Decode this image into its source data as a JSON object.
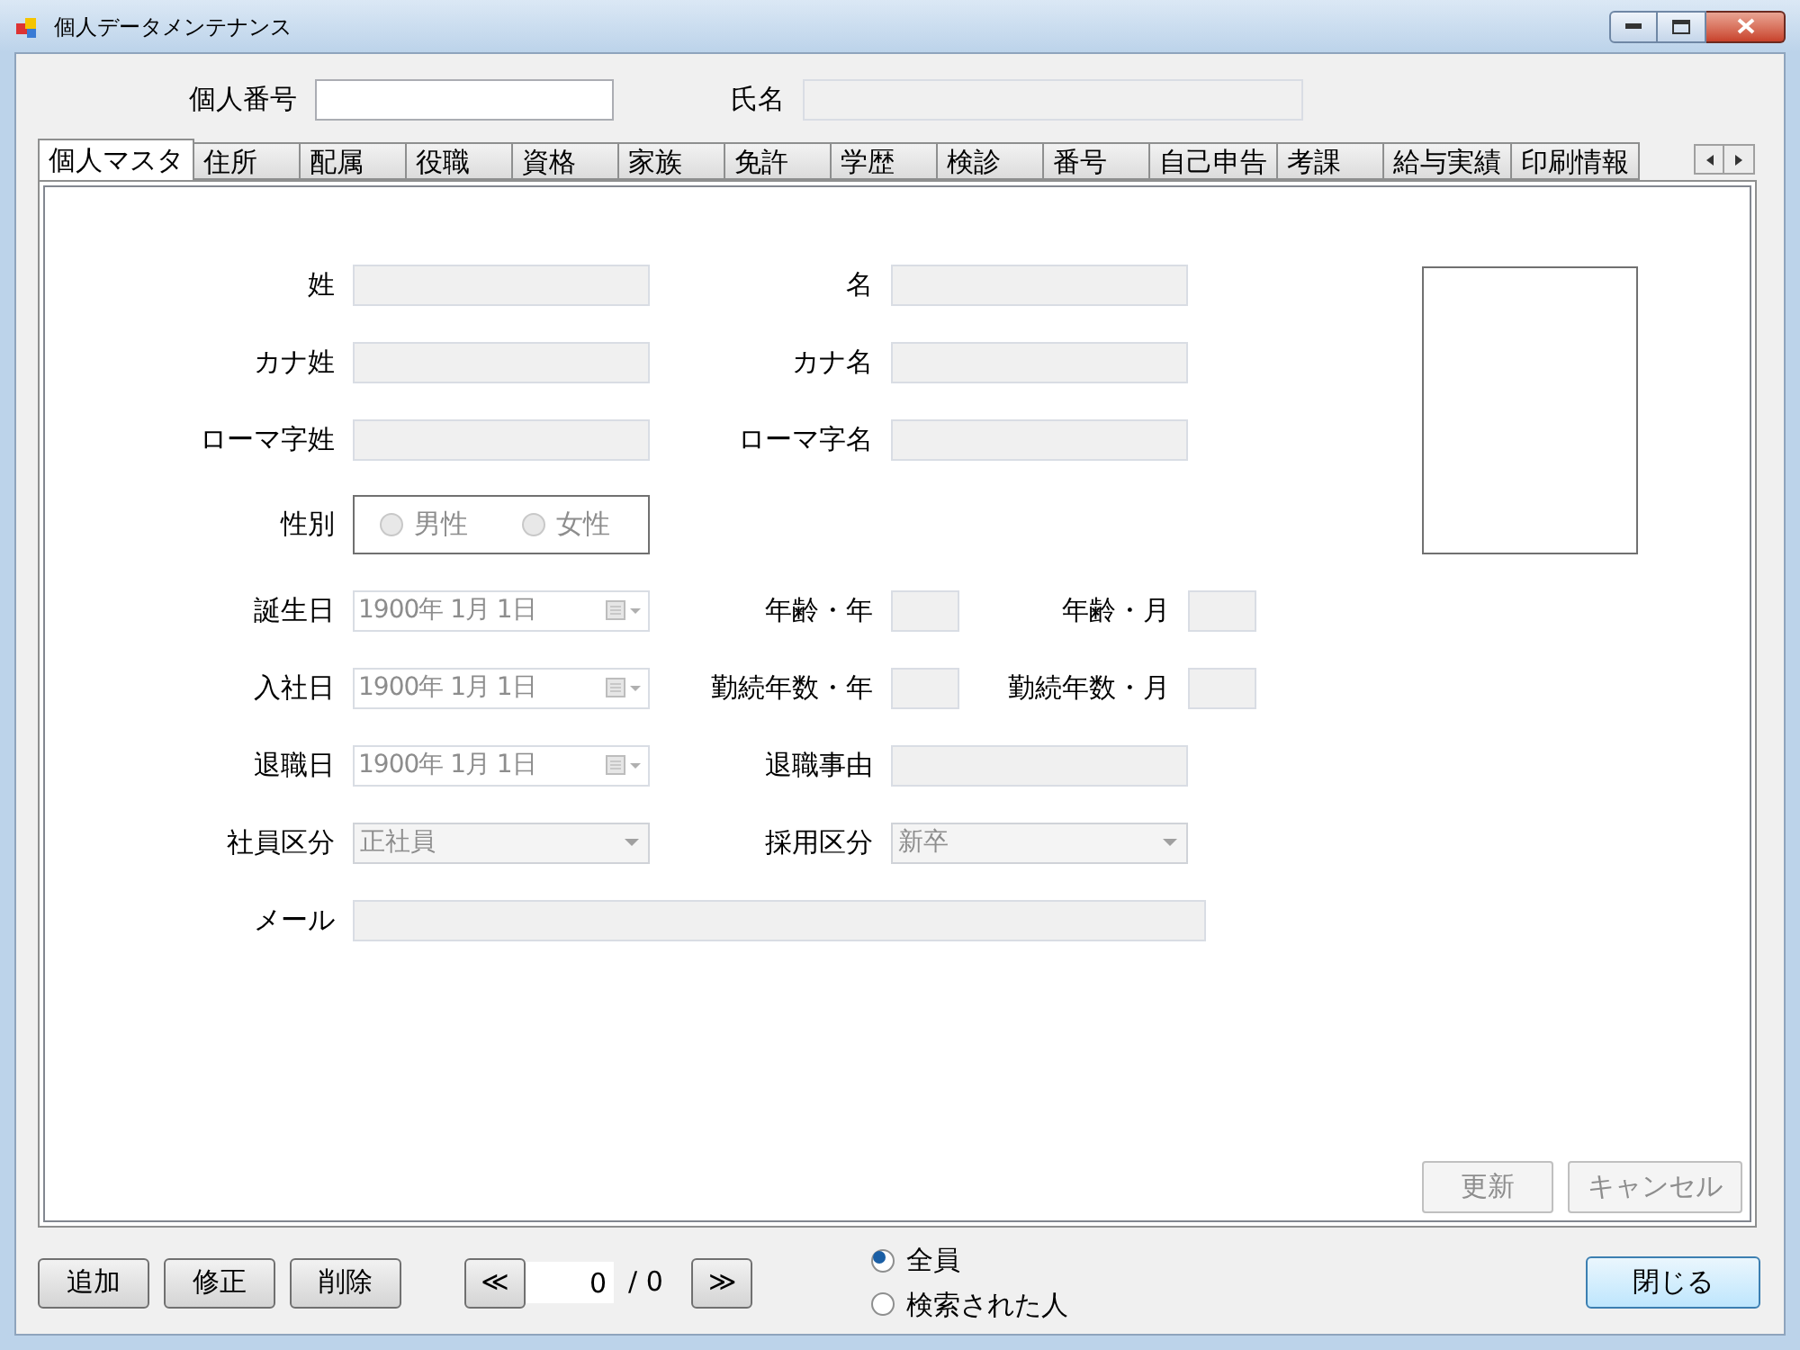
{
  "window": {
    "title": "個人データメンテナンス"
  },
  "header": [
    {
      "label": "個人番号",
      "disabled": false
    },
    {
      "label": "氏名",
      "disabled": true
    }
  ],
  "tabs": [
    {
      "label": "個人マスタ",
      "selected": true
    },
    {
      "label": "住所",
      "selected": false
    },
    {
      "label": "配属",
      "selected": false
    },
    {
      "label": "役職",
      "selected": false
    },
    {
      "label": "資格",
      "selected": false
    },
    {
      "label": "家族",
      "selected": false
    },
    {
      "label": "免許",
      "selected": false
    },
    {
      "label": "学歴",
      "selected": false
    },
    {
      "label": "検診",
      "selected": false
    },
    {
      "label": "番号",
      "selected": false
    },
    {
      "label": "自己申告",
      "selected": false
    },
    {
      "label": "考課",
      "selected": false
    },
    {
      "label": "給与実績",
      "selected": false
    },
    {
      "label": "印刷情報",
      "selected": false
    }
  ],
  "form": [
    [
      {
        "label": "姓",
        "kind": "text",
        "disabled": true
      },
      {
        "label": "名",
        "kind": "text",
        "disabled": true
      }
    ],
    [
      {
        "label": "カナ姓",
        "kind": "text",
        "disabled": true
      },
      {
        "label": "カナ名",
        "kind": "text",
        "disabled": true
      }
    ],
    [
      {
        "label": "ローマ字姓",
        "kind": "text",
        "disabled": true
      },
      {
        "label": "ローマ字名",
        "kind": "text",
        "disabled": true
      }
    ],
    [
      {
        "label": "性別",
        "kind": "radio_group",
        "disabled": true,
        "options": [
          {
            "label": "男性",
            "selected": false
          },
          {
            "label": "女性",
            "selected": false
          }
        ]
      }
    ],
    [
      {
        "label": "誕生日",
        "kind": "date",
        "value": "1900年 1月 1日",
        "disabled": true
      },
      {
        "label": "年齢・年",
        "kind": "short",
        "disabled": true
      },
      {
        "label": "年齢・月",
        "kind": "short",
        "disabled": true
      }
    ],
    [
      {
        "label": "入社日",
        "kind": "date",
        "value": "1900年 1月 1日",
        "disabled": true
      },
      {
        "label": "勤続年数・年",
        "kind": "short",
        "disabled": true
      },
      {
        "label": "勤続年数・月",
        "kind": "short",
        "disabled": true
      }
    ],
    [
      {
        "label": "退職日",
        "kind": "date",
        "value": "1900年 1月 1日",
        "disabled": true
      },
      {
        "label": "退職事由",
        "kind": "text",
        "disabled": true
      }
    ],
    [
      {
        "label": "社員区分",
        "kind": "select",
        "value": "正社員",
        "disabled": true
      },
      {
        "label": "採用区分",
        "kind": "select",
        "value": "新卒",
        "disabled": true
      }
    ],
    [
      {
        "label": "メール",
        "kind": "wide",
        "disabled": true
      }
    ]
  ],
  "panel_buttons": [
    {
      "label": "更新",
      "disabled": true
    },
    {
      "label": "キャンセル",
      "disabled": true
    }
  ],
  "actions": [
    {
      "label": "追加"
    },
    {
      "label": "修正"
    },
    {
      "label": "削除"
    }
  ],
  "pager": {
    "prev": "≪",
    "value": "0",
    "total": "/ 0",
    "next": "≫"
  },
  "filter": [
    {
      "label": "全員",
      "selected": true
    },
    {
      "label": "検索された人",
      "selected": false
    }
  ],
  "close": "閉じる"
}
